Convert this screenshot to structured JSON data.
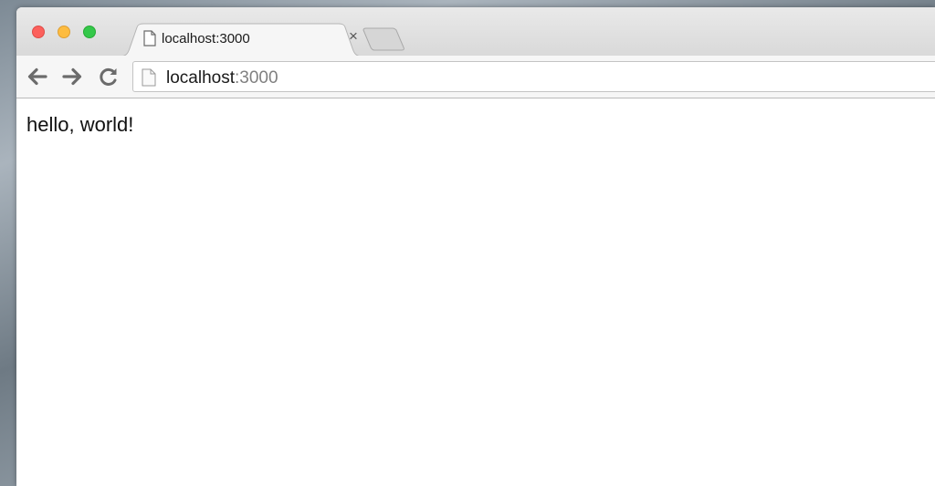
{
  "window": {
    "controls": {
      "close": "close",
      "minimize": "minimize",
      "zoom": "zoom"
    }
  },
  "tab": {
    "title": "localhost:3000",
    "close_glyph": "×",
    "favicon": "page-icon"
  },
  "toolbar": {
    "back_icon": "arrow-left-icon",
    "forward_icon": "arrow-right-icon",
    "reload_icon": "reload-icon"
  },
  "omnibox": {
    "host": "localhost",
    "port": ":3000",
    "icon": "page-icon"
  },
  "page": {
    "body_text": "hello, world!"
  },
  "colors": {
    "close": "#fc605c",
    "minimize": "#fdbc40",
    "zoom": "#34c84a",
    "url_port": "#808080"
  }
}
